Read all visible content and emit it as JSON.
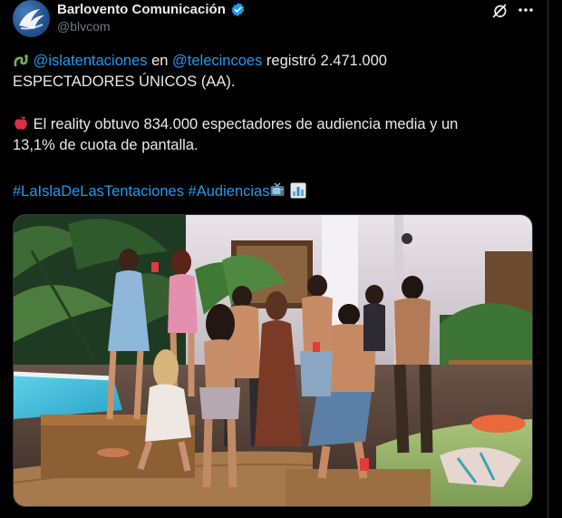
{
  "author": {
    "display_name": "Barlovento Comunicación",
    "handle": "@blvcom"
  },
  "post": {
    "line1_mention_a": "@islatentaciones",
    "line1_text_a": " en ",
    "line1_mention_b": "@telecincoes",
    "line1_text_b": " registró 2.471.000",
    "line2": "ESPECTADORES ÚNICOS (AA).",
    "line3": " El reality obtuvo 834.000 espectadores de audiencia media y un",
    "line4": "13,1% de cuota de pantalla.",
    "hashtag_a": "#LaIslaDeLasTentaciones",
    "hashtag_b": "#Audiencias"
  },
  "icons": {
    "verified": "verified-badge-icon",
    "grok": "grok-icon",
    "more": "more-options-icon"
  },
  "colors": {
    "background": "#000000",
    "text": "#e7e9ea",
    "link": "#1d9bf0",
    "secondary": "#71767b",
    "verified": "#1d9bf0"
  }
}
